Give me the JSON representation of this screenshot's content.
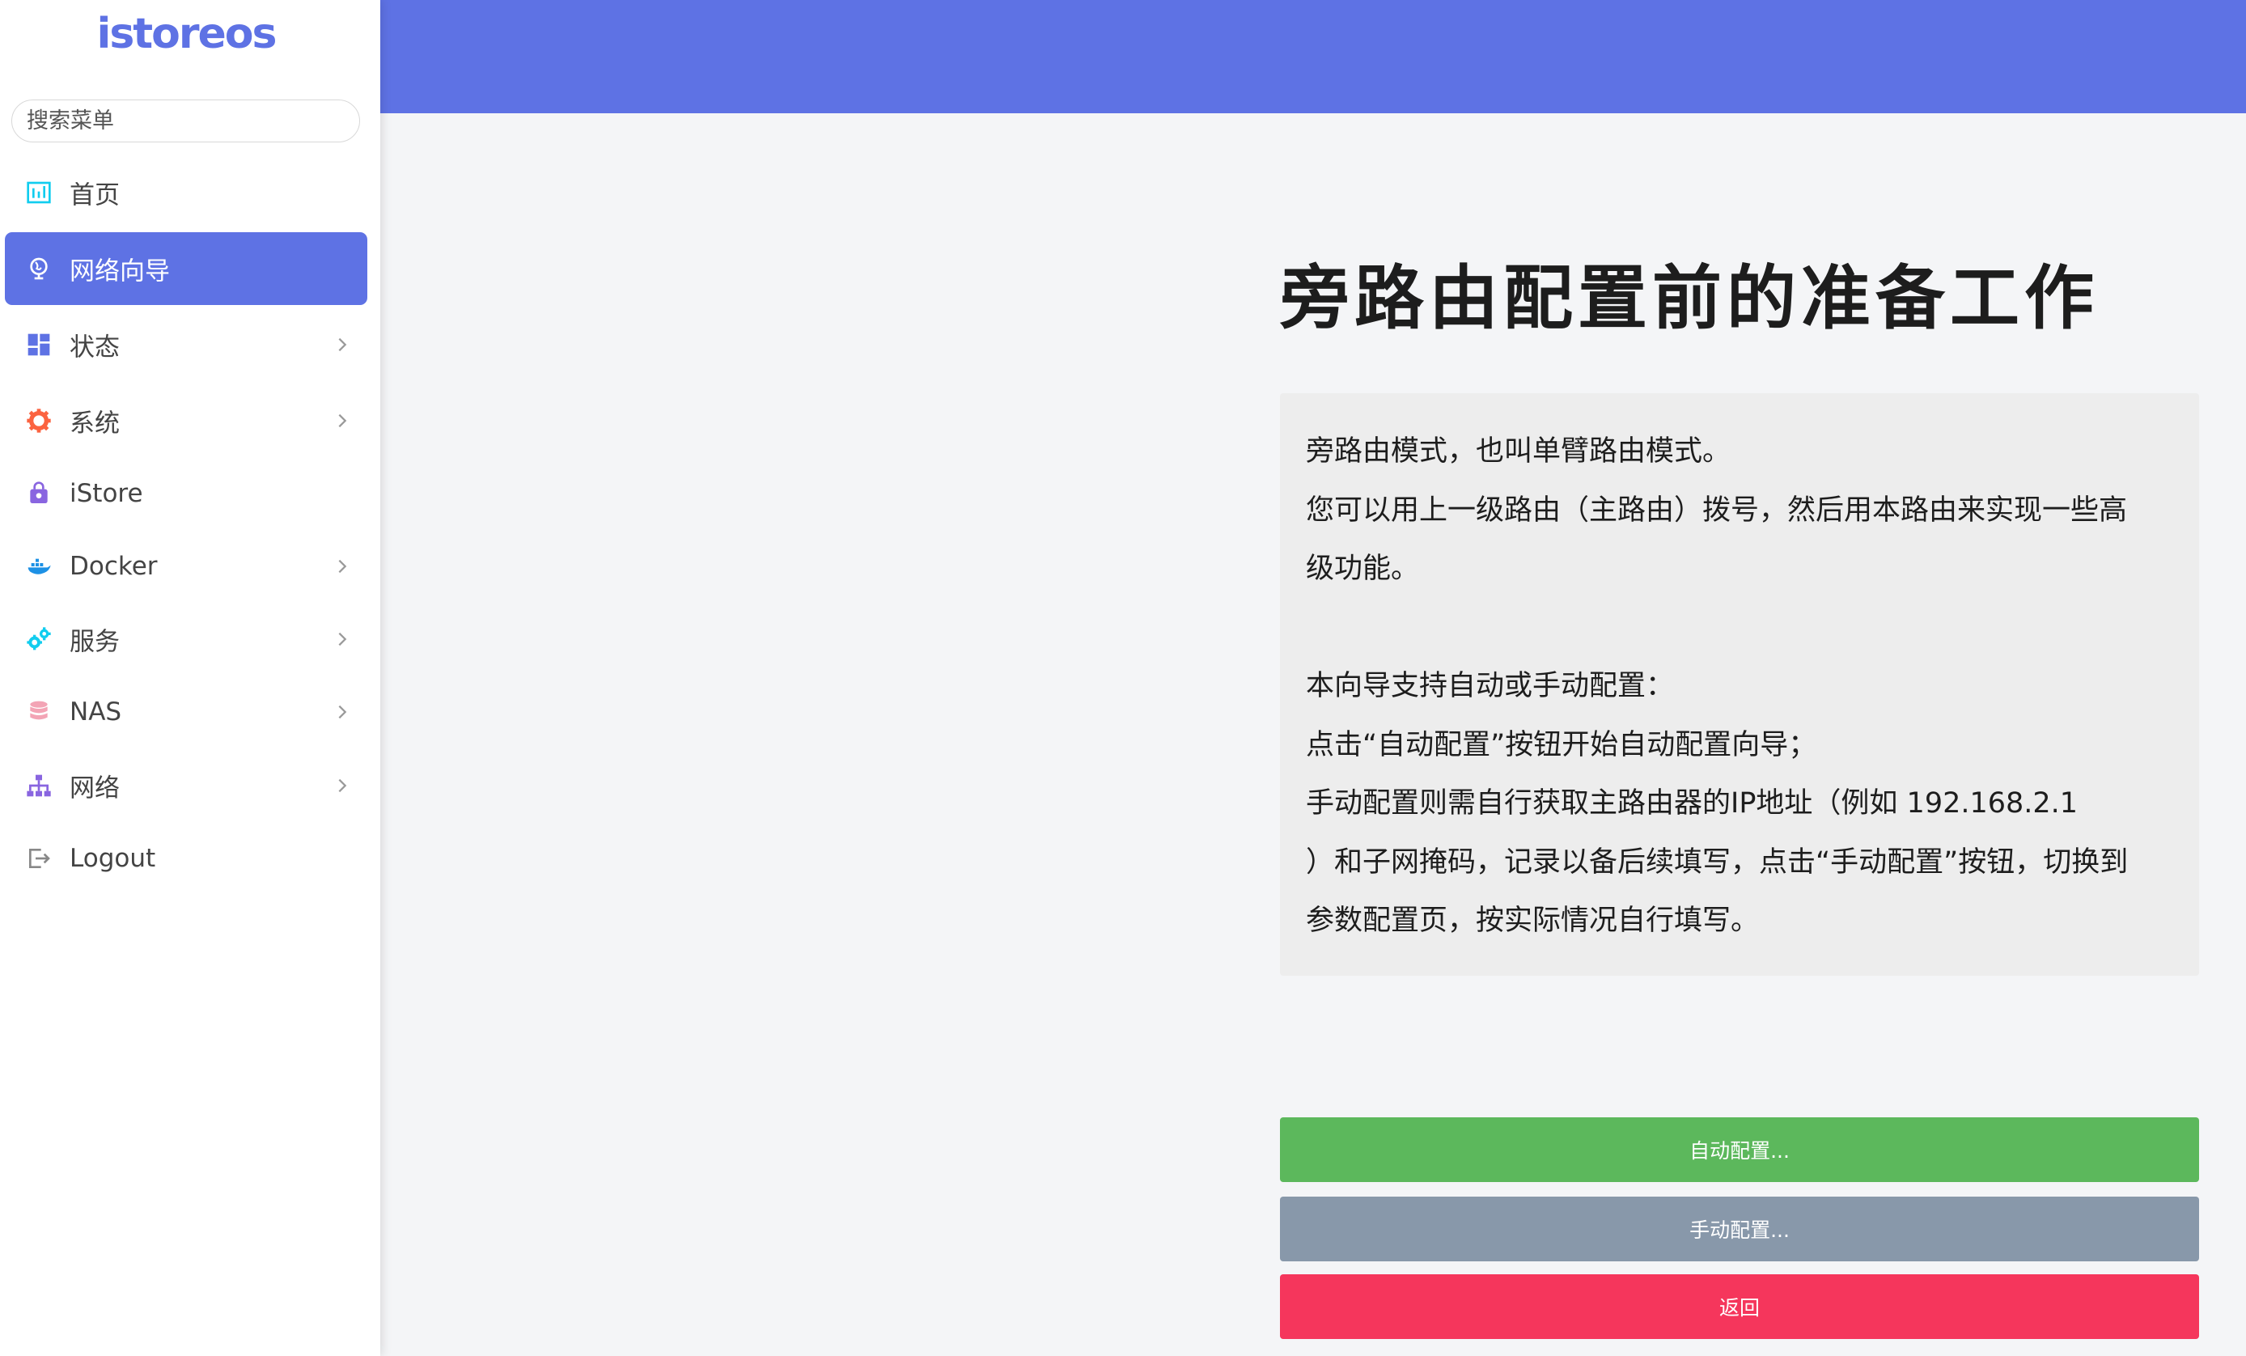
{
  "app": {
    "logo_text": "istoreos"
  },
  "sidebar": {
    "search_placeholder": "搜索菜单",
    "items": [
      {
        "label": "首页",
        "icon": "dashboard-chart-icon",
        "has_children": false,
        "active": false
      },
      {
        "label": "网络向导",
        "icon": "globe-icon",
        "has_children": false,
        "active": true
      },
      {
        "label": "状态",
        "icon": "grid-icon",
        "has_children": true,
        "active": false
      },
      {
        "label": "系统",
        "icon": "gear-icon",
        "has_children": true,
        "active": false
      },
      {
        "label": "iStore",
        "icon": "bag-icon",
        "has_children": false,
        "active": false
      },
      {
        "label": "Docker",
        "icon": "docker-whale-icon",
        "has_children": true,
        "active": false
      },
      {
        "label": "服务",
        "icon": "cogs-icon",
        "has_children": true,
        "active": false
      },
      {
        "label": "NAS",
        "icon": "database-icon",
        "has_children": true,
        "active": false
      },
      {
        "label": "网络",
        "icon": "network-tree-icon",
        "has_children": true,
        "active": false
      },
      {
        "label": "Logout",
        "icon": "logout-icon",
        "has_children": false,
        "active": false
      }
    ]
  },
  "main": {
    "title": "旁路由配置前的准备工作",
    "description_lines": [
      "旁路由模式，也叫单臂路由模式。",
      "您可以用上一级路由（主路由）拨号，然后用本路由来实现一些高",
      "级功能。",
      "",
      "本向导支持自动或手动配置：",
      "点击“自动配置”按钮开始自动配置向导；",
      "手动配置则需自行获取主路由器的IP地址（例如 192.168.2.1",
      "）和子网掩码，记录以备后续填写，点击“手动配置”按钮，切换到",
      "参数配置页，按实际情况自行填写。"
    ],
    "buttons": {
      "auto": "自动配置...",
      "manual": "手动配置...",
      "back": "返回"
    }
  },
  "colors": {
    "accent": "#5e72e4",
    "success": "#5cb85c",
    "secondary": "#8898aa",
    "danger": "#f5365c"
  }
}
